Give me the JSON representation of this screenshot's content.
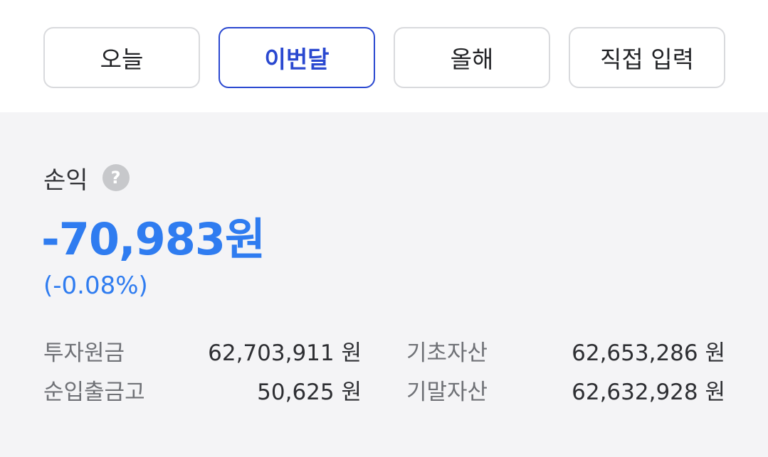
{
  "tabs": [
    {
      "label": "오늘"
    },
    {
      "label": "이번달"
    },
    {
      "label": "올해"
    },
    {
      "label": "직접 입력"
    }
  ],
  "active_tab": "이번달",
  "profit_loss": {
    "title": "손익",
    "help_icon": "?",
    "amount": "-70,983원",
    "rate": "(-0.08%)"
  },
  "summary": {
    "investment_principal": {
      "label": "투자원금",
      "value": "62,703,911 원"
    },
    "net_deposit_withdrawal": {
      "label": "순입출금고",
      "value": "50,625 원"
    },
    "beginning_assets": {
      "label": "기초자산",
      "value": "62,653,286 원"
    },
    "ending_assets": {
      "label": "기말자산",
      "value": "62,632,928 원"
    }
  },
  "colors": {
    "accent": "#2a48d0",
    "loss": "#2f7cf0",
    "panel_bg": "#f4f4f6"
  }
}
